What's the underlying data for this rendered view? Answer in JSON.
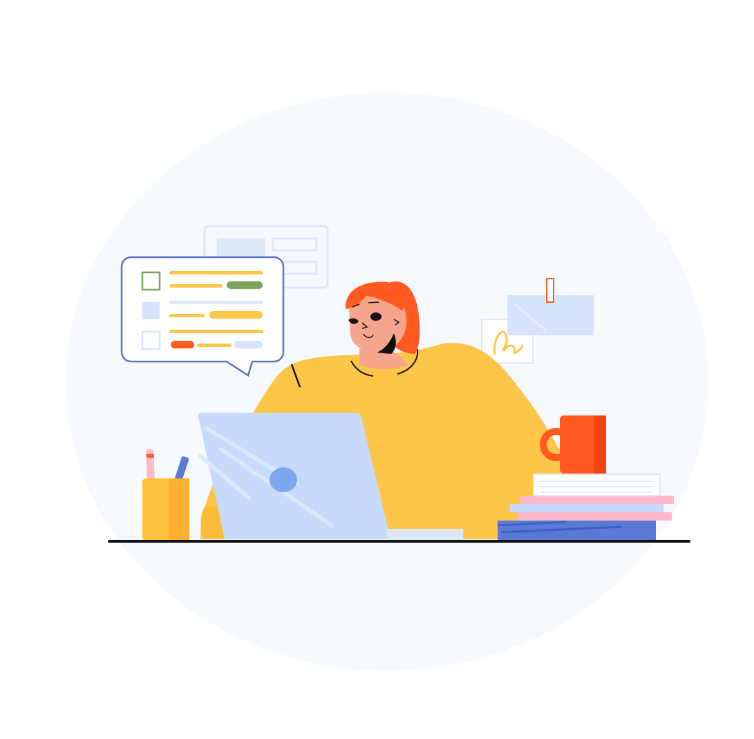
{
  "illustration": {
    "palette": {
      "background": "#ffffff",
      "backdrop_blob": "#f6f9fd",
      "sweater": "#fdc648",
      "hair": "#ff5a1f",
      "skin": "#f5a58c",
      "laptop": "#c7dafc",
      "laptop_logo": "#7fa7f0",
      "mug": "#ff5a1f",
      "pencil_cup": "#ffc23d",
      "book_blue": "#5a7ad6",
      "book_pink": "#ffb7cc",
      "bubble_border": "#5a74c9",
      "check_green": "#7ea35c",
      "desk_line": "#111111"
    },
    "checklist_bubble": {
      "rows": [
        {
          "checkbox": "outlined-green",
          "status_pill_color": "#7ea35c"
        },
        {
          "checkbox": "filled-blue",
          "status_pill_color": "#fdc648"
        },
        {
          "checkbox": "outlined-blue",
          "status_pill_color": "#ff5a1f"
        }
      ]
    },
    "icons": [
      "checklist-speech-bubble-icon",
      "browser-window-icon",
      "sticky-note-icon",
      "signature-card-icon",
      "coffee-mug-icon",
      "pencil-cup-icon",
      "laptop-icon",
      "book-stack-icon"
    ]
  }
}
